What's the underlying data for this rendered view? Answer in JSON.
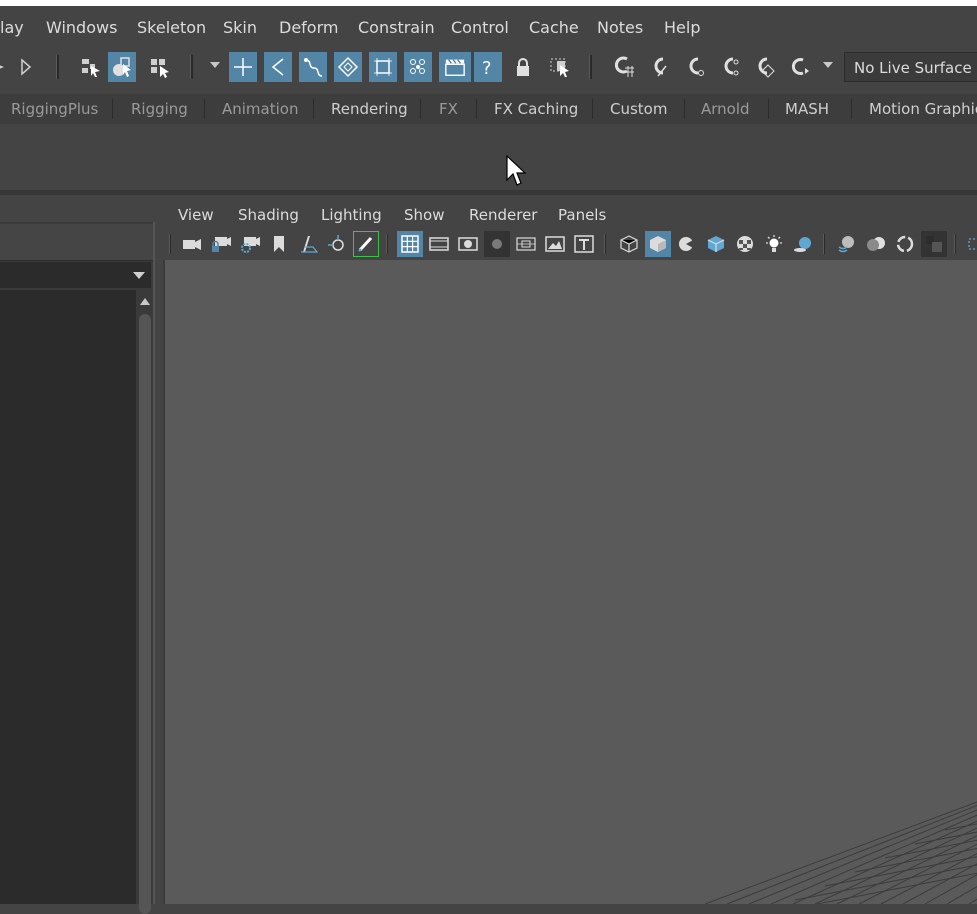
{
  "main_menu": {
    "items": [
      "lay",
      "Windows",
      "Skeleton",
      "Skin",
      "Deform",
      "Constrain",
      "Control",
      "Cache",
      "Notes",
      "Help"
    ]
  },
  "status_line": {
    "live_surface": "No Live Surface",
    "icons": [
      "arrow-right-icon",
      "triangle-play-icon",
      "select-hierarchy-icon",
      "select-object-icon",
      "select-component-icon",
      "snap-to-grid-icon",
      "snap-to-curve-icon",
      "snap-to-point-icon",
      "snap-to-view-plane-icon",
      "make-live-icon",
      "lock-icon",
      "select-region-icon",
      "history-icon",
      "magnet-icons"
    ]
  },
  "shelf_tabs": {
    "items": [
      {
        "label": "RiggingPlus",
        "dim": true
      },
      {
        "label": "Rigging",
        "dim": true
      },
      {
        "label": "Animation",
        "dim": true
      },
      {
        "label": "Rendering",
        "dim": false
      },
      {
        "label": "FX",
        "dim": true
      },
      {
        "label": "FX Caching",
        "dim": false
      },
      {
        "label": "Custom",
        "dim": false
      },
      {
        "label": "Arnold",
        "dim": true
      },
      {
        "label": "MASH",
        "dim": false
      },
      {
        "label": "Motion Graphics",
        "dim": false
      }
    ]
  },
  "viewport_panel": {
    "menu": [
      "View",
      "Shading",
      "Lighting",
      "Show",
      "Renderer",
      "Panels"
    ]
  },
  "colors": {
    "accent": "#5285a6",
    "background": "#444444",
    "viewport": "#5a5a5a"
  }
}
